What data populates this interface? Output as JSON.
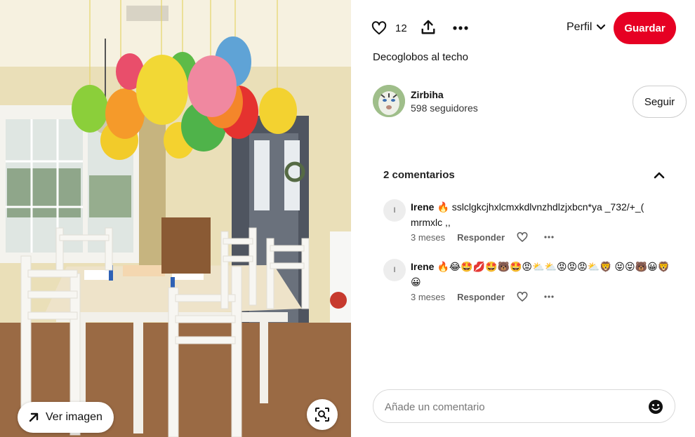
{
  "photo": {
    "view_image_label": "Ver imagen"
  },
  "toolbar": {
    "like_count": "12",
    "profile_label": "Perfil",
    "save_label": "Guardar"
  },
  "pin": {
    "title": "Decoglobos al techo"
  },
  "author": {
    "name": "Zirbiha",
    "followers": "598 seguidores",
    "follow_label": "Seguir"
  },
  "comments": {
    "header": "2 comentarios",
    "items": [
      {
        "initial": "I",
        "author": "Irene",
        "text": "🔥 sslclgkcjhxlcmxkdlvnzhdlzjxbcn*ya _732/+_( mrmxlc ,,",
        "time": "3 meses",
        "reply_label": "Responder"
      },
      {
        "initial": "I",
        "author": "Irene",
        "text": "🔥😂🤩💋🤩🐻🤩😡⛅⛅😡😡😡⛅🦁 😝😝🐻😀🦁😀",
        "time": "3 meses",
        "reply_label": "Responder"
      }
    ]
  },
  "composer": {
    "placeholder": "Añade un comentario"
  },
  "colors": {
    "accent": "#e60023",
    "text": "#111111",
    "muted": "#5f5f5f"
  }
}
